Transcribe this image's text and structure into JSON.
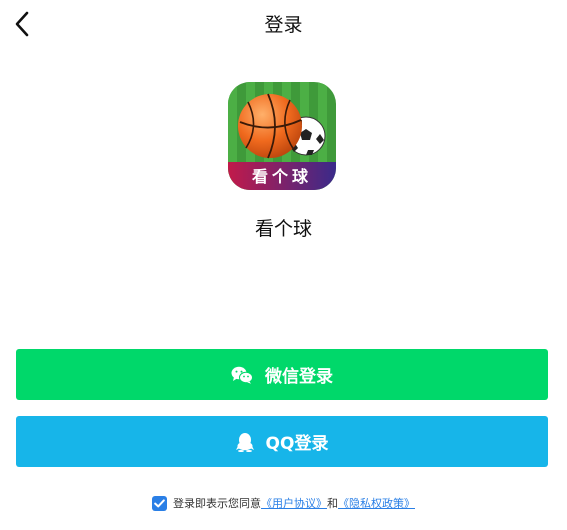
{
  "header": {
    "title": "登录",
    "back_icon": "chevron-left-icon"
  },
  "app": {
    "name": "看个球",
    "logo_text": "看个球",
    "logo_icon": "basketball-football-logo"
  },
  "buttons": {
    "wechat": {
      "label": "微信登录",
      "icon": "wechat-icon",
      "color": "#00d86a"
    },
    "qq": {
      "label": "QQ登录",
      "icon": "qq-icon",
      "color": "#17b5e9"
    }
  },
  "agreement": {
    "checked": true,
    "prefix": "登录即表示您同意",
    "user_agreement": "《用户协议》",
    "conjunction": "和",
    "privacy_policy": "《隐私权政策》",
    "link_color": "#2a7fe6"
  }
}
